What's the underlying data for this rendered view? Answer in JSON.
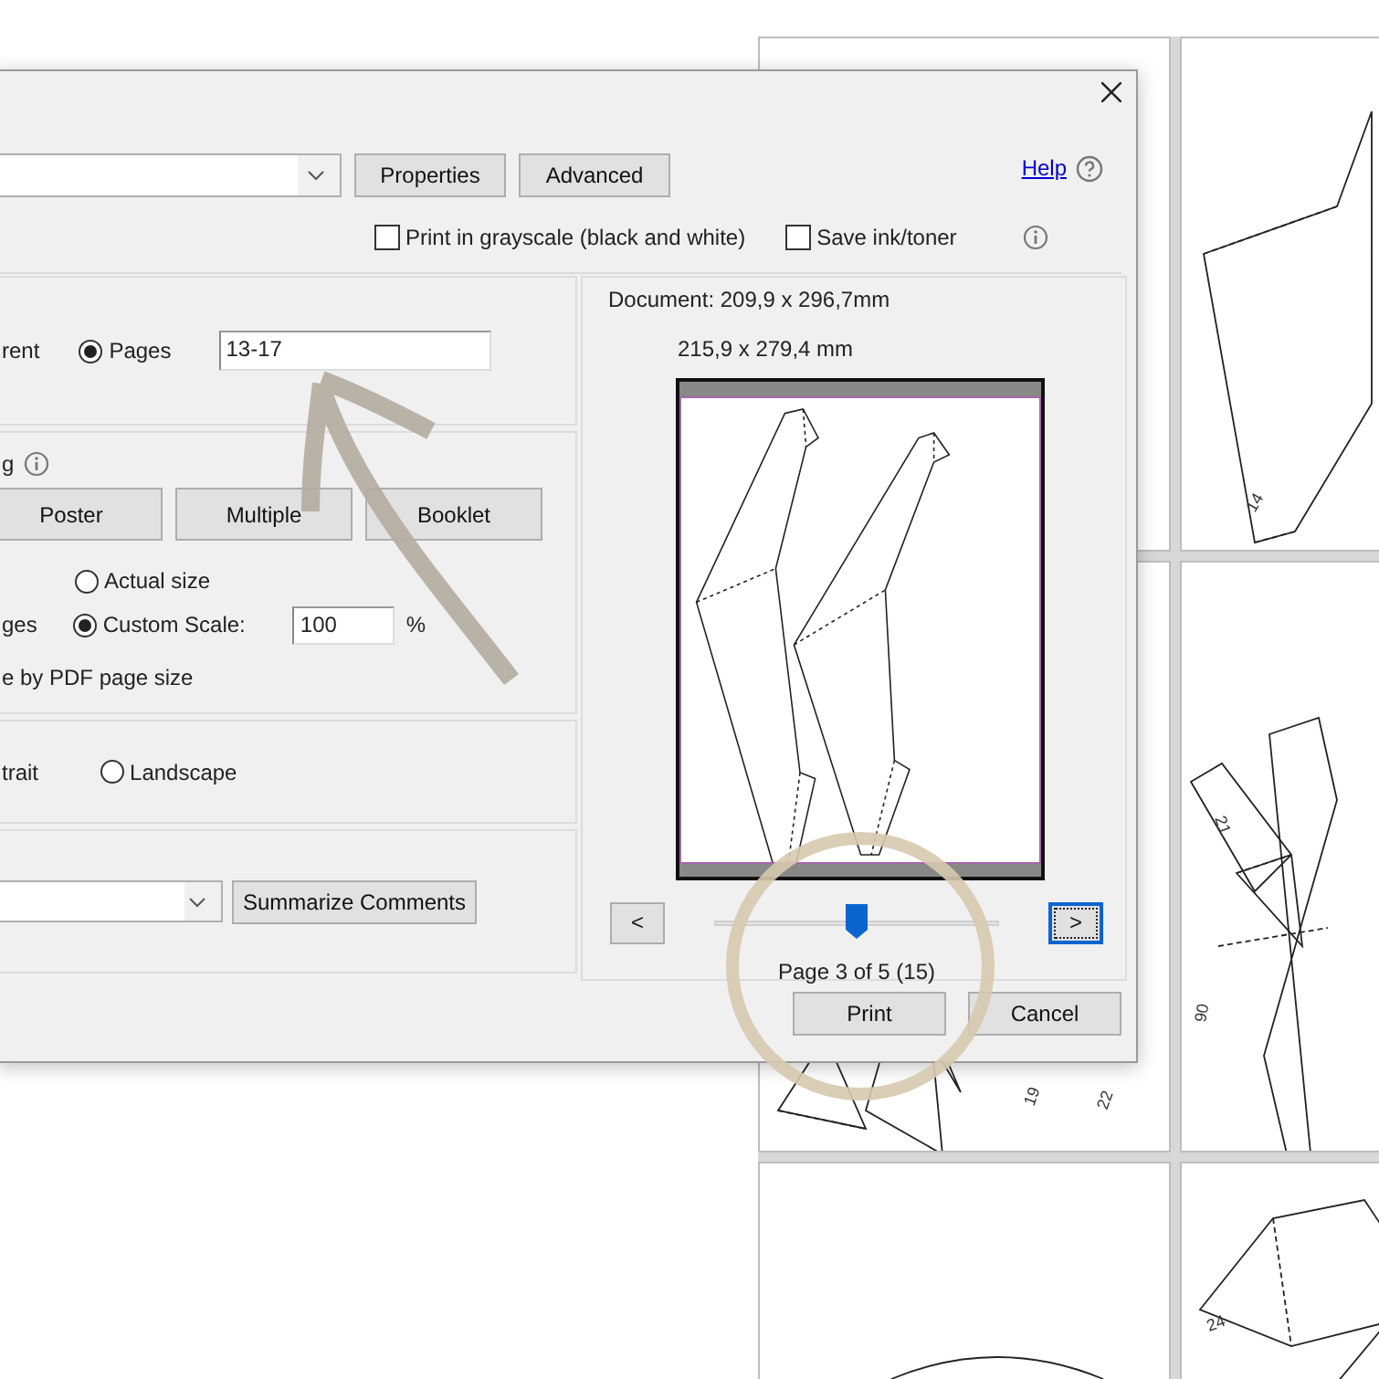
{
  "dialog": {
    "top_buttons": [
      "Properties",
      "Advanced"
    ],
    "help": "Help",
    "options": [
      {
        "label": "Print in grayscale (black and white)",
        "checked": false
      },
      {
        "label": "Save ink/toner",
        "checked": false
      }
    ],
    "pages": {
      "cut_label": "rent",
      "radio": {
        "label": "Pages",
        "selected": true
      },
      "value": "13-17"
    },
    "sizing": {
      "cut_title": "g",
      "modes": [
        "Poster",
        "Multiple",
        "Booklet"
      ],
      "radios": [
        {
          "label": "Actual size",
          "selected": false
        },
        {
          "label": "Custom Scale:",
          "selected": true
        }
      ],
      "cut_label": "ges",
      "scale_value": "100",
      "percent": "%",
      "cut_option": "e by PDF page size"
    },
    "orientation": {
      "cut_label": "trait",
      "radio": {
        "label": "Landscape",
        "selected": false
      }
    },
    "comments": {
      "button": "Summarize Comments"
    },
    "preview": {
      "document": "Document: 209,9 x 296,7mm",
      "paper": "215,9 x 279,4 mm",
      "prev": "<",
      "next": ">",
      "slider": {
        "level": 0.5
      },
      "status": "Page 3 of 5 (15)"
    },
    "actions": [
      "Print",
      "Cancel"
    ]
  },
  "sheet_labels": [
    "14",
    "19",
    "22",
    "21",
    "90",
    "24"
  ]
}
